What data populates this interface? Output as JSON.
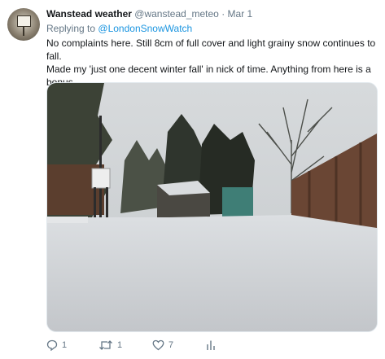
{
  "tweet": {
    "author_name": "Wanstead weather",
    "author_handle": "@wanstead_meteo",
    "separator": "·",
    "date": "Mar 1",
    "reply_prefix": "Replying to",
    "reply_mention": "@LondonSnowWatch",
    "text_line1": "No complaints here. Still 8cm of full cover and light grainy snow continues to fall.",
    "text_line2": "Made my 'just one decent winter fall' in nick of time. Anything from here is a bonus."
  },
  "actions": {
    "reply_count": "1",
    "retweet_count": "1",
    "like_count": "7",
    "reply_icon": "speech-bubble",
    "retweet_icon": "retweet-arrows",
    "like_icon": "heart",
    "analytics_icon": "bar-chart"
  },
  "colors": {
    "link": "#1b95e0",
    "muted": "#657786",
    "text": "#14171a"
  }
}
